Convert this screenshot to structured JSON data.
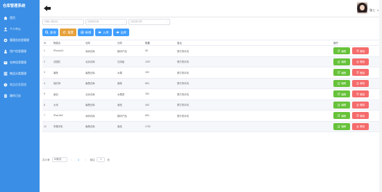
{
  "app": {
    "title": "仓库管理系统"
  },
  "sidebar": {
    "items": [
      {
        "label": "首页",
        "icon": "home-icon"
      },
      {
        "label": "个人中心",
        "icon": "user-icon"
      },
      {
        "label": "管理员信息管理",
        "icon": "admin-icon"
      },
      {
        "label": "用户信息管理",
        "icon": "users-icon"
      },
      {
        "label": "仓库信息管理",
        "icon": "warehouse-icon"
      },
      {
        "label": "物品分类管理",
        "icon": "category-icon"
      },
      {
        "label": "物品信息管理",
        "icon": "goods-icon"
      },
      {
        "label": "操作日志",
        "icon": "log-icon"
      }
    ]
  },
  "header": {
    "username": "张三",
    "caret": "▾"
  },
  "filters": {
    "name_placeholder": "请输入物品名",
    "warehouse_placeholder": "请选择仓库",
    "category_placeholder": "请选择分类"
  },
  "toolbar": {
    "query": "查询",
    "reset": "重置",
    "add": "新增",
    "stock_in": "入库",
    "stock_out": "出库"
  },
  "table": {
    "columns": [
      "ID",
      "物品名",
      "仓库",
      "分类",
      "数量",
      "备注",
      "操作"
    ],
    "rows": [
      [
        "1",
        "iPhone14",
        "深圳仓库",
        "数码产品",
        "95",
        "很牛的手机",
        ""
      ],
      [
        "2",
        "法国红",
        "北京仓库",
        "日用品",
        "1007",
        "很牛的手机",
        ""
      ],
      [
        "3",
        "薯条",
        "南昌仓库",
        "水果",
        "320",
        "很牛的手机",
        ""
      ],
      [
        "4",
        "西红柿",
        "南昌仓库",
        "蔬菜",
        "800",
        "很牛的手机",
        ""
      ],
      [
        "5",
        "面包",
        "北京仓库",
        "水果类",
        "300",
        "很牛的手机",
        ""
      ],
      [
        "6",
        "大米",
        "南昌仓库",
        "食品",
        "400",
        "很牛的手机",
        ""
      ],
      [
        "7",
        "iPad Air5",
        "深圳仓库",
        "数码产品",
        "800",
        "很牛的手机",
        ""
      ],
      [
        "12",
        "苹果手机",
        "南昌仓库",
        "食品",
        "1700",
        "",
        ""
      ]
    ],
    "edit_label": "编辑",
    "delete_label": "删除"
  },
  "pagination": {
    "total": "共 8 条",
    "page_size": "10条/页",
    "prev": "<",
    "current": "1",
    "next": ">",
    "goto_prefix": "前往",
    "goto_value": "1",
    "goto_suffix": "页"
  }
}
